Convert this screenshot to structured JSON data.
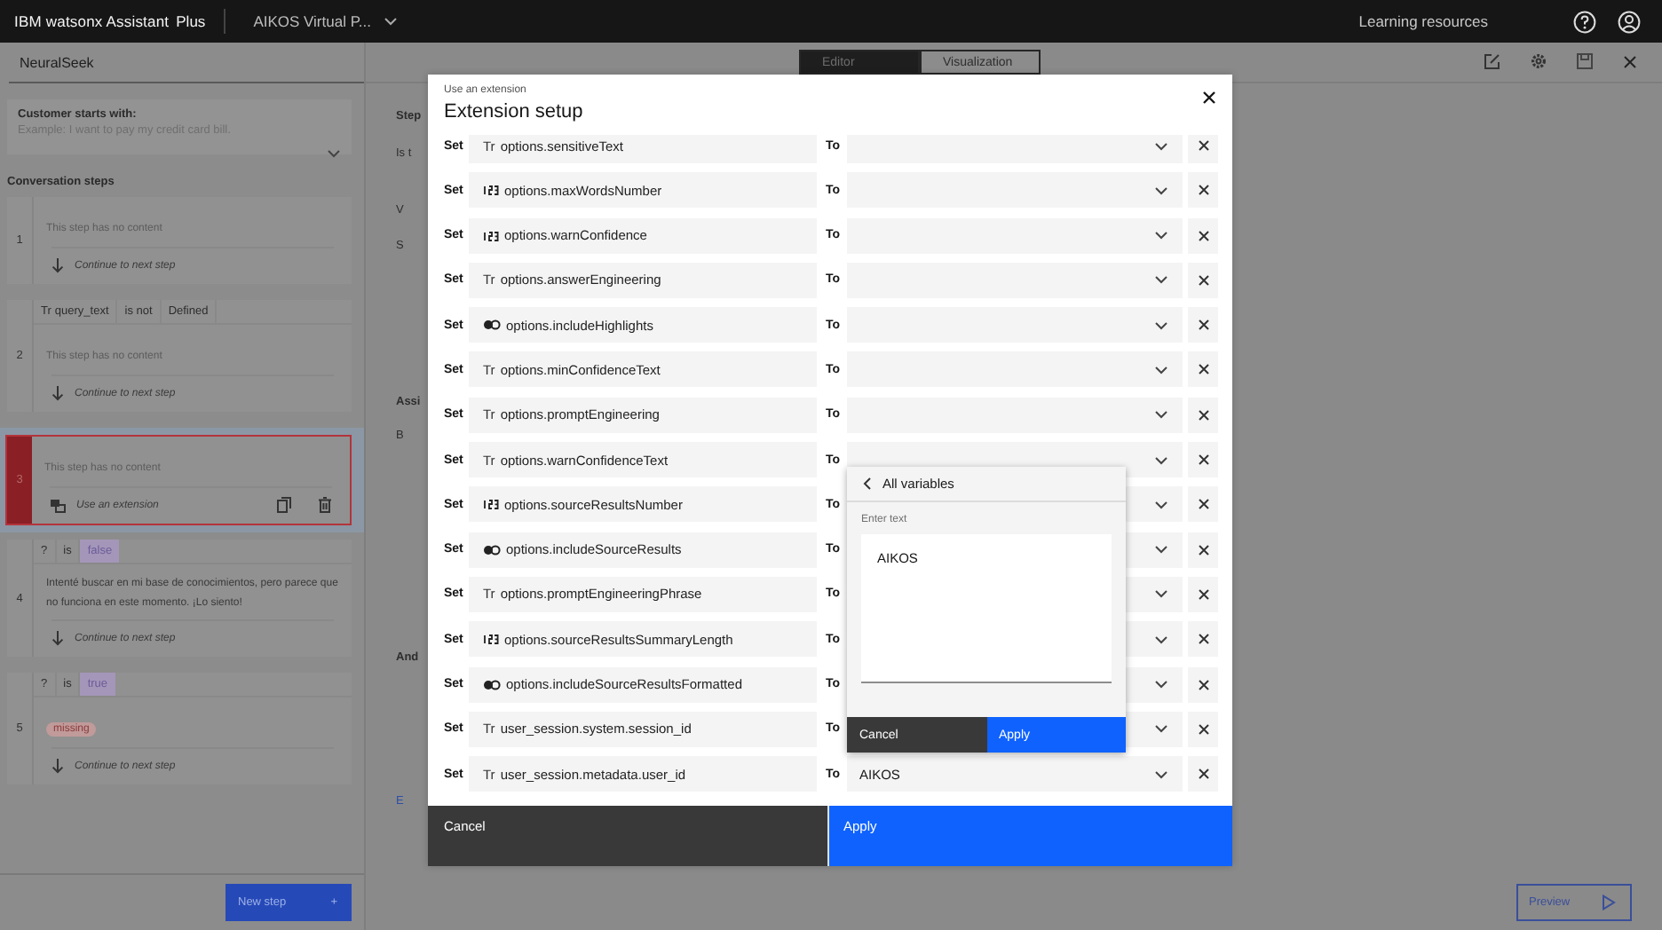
{
  "header": {
    "product": "IBM watsonx Assistant",
    "plan": "Plus",
    "assistant": "AIKOS Virtual P...",
    "link": "Learning resources"
  },
  "sidebar": {
    "action_title": "NeuralSeek",
    "starts_with": {
      "label": "Customer starts with:",
      "placeholder": "Example: I want to pay my credit card bill."
    },
    "steps_title": "Conversation steps",
    "steps": [
      {
        "number": "1",
        "selected": false,
        "content": {
          "kind": "empty",
          "text": "This step has no content"
        },
        "action": {
          "kind": "continue",
          "label": "Continue to next step"
        }
      },
      {
        "number": "2",
        "selected": false,
        "condition": [
          {
            "kind": "variable",
            "icon": "Tr",
            "text": "query_text"
          },
          {
            "kind": "operator",
            "text": "is not"
          },
          {
            "kind": "value",
            "text": "Defined"
          }
        ],
        "content": {
          "kind": "empty",
          "text": "This step has no content"
        },
        "action": {
          "kind": "continue",
          "label": "Continue to next step"
        }
      },
      {
        "number": "3",
        "selected": true,
        "content": {
          "kind": "empty",
          "text": "This step has no content"
        },
        "action": {
          "kind": "extension",
          "label": "Use an extension"
        }
      },
      {
        "number": "4",
        "selected": false,
        "condition": [
          {
            "kind": "variable",
            "text": "?"
          },
          {
            "kind": "operator",
            "text": "is"
          },
          {
            "kind": "tag",
            "text": "false"
          }
        ],
        "content": {
          "kind": "text",
          "text": "Intenté buscar en mi base de conocimientos, pero parece que no funciona en este momento. ¡Lo siento!"
        },
        "action": {
          "kind": "continue",
          "label": "Continue to next step"
        }
      },
      {
        "number": "5",
        "selected": false,
        "condition": [
          {
            "kind": "variable",
            "text": "?"
          },
          {
            "kind": "operator",
            "text": "is"
          },
          {
            "kind": "tag",
            "text": "true"
          }
        ],
        "content": {
          "kind": "tag",
          "text": "missing"
        },
        "action": {
          "kind": "continue",
          "label": "Continue to next step"
        }
      }
    ],
    "new_step": "New step",
    "new_step_icon": "+"
  },
  "editor_tabs": [
    {
      "label": "Editor",
      "selected": true
    },
    {
      "label": "Visualization",
      "selected": false
    }
  ],
  "background_fragments": [
    {
      "kind": "heading",
      "text": "Step"
    },
    {
      "kind": "text",
      "text": "Is t"
    },
    {
      "kind": "text",
      "text": "V"
    },
    {
      "kind": "text",
      "text": "S"
    },
    {
      "kind": "heading",
      "text": "Assi"
    },
    {
      "kind": "text",
      "text": "B"
    },
    {
      "kind": "heading",
      "text": "And"
    },
    {
      "kind": "link",
      "text": "E"
    }
  ],
  "preview": "Preview",
  "modal": {
    "subtitle": "Use an extension",
    "title": "Extension setup",
    "rows": [
      {
        "kind": "text",
        "type_icon": "Tr",
        "set_label": "Set",
        "name": "options.sensitiveText",
        "to_label": "To"
      },
      {
        "kind": "number",
        "set_label": "Set",
        "name": "options.maxWordsNumber",
        "to_label": "To"
      },
      {
        "kind": "number",
        "set_label": "Set",
        "name": "options.warnConfidence",
        "to_label": "To"
      },
      {
        "kind": "text",
        "type_icon": "Tr",
        "set_label": "Set",
        "name": "options.answerEngineering",
        "to_label": "To"
      },
      {
        "kind": "boolean",
        "set_label": "Set",
        "name": "options.includeHighlights",
        "to_label": "To"
      },
      {
        "kind": "text",
        "type_icon": "Tr",
        "set_label": "Set",
        "name": "options.minConfidenceText",
        "to_label": "To"
      },
      {
        "kind": "text",
        "type_icon": "Tr",
        "set_label": "Set",
        "name": "options.promptEngineering",
        "to_label": "To"
      },
      {
        "kind": "text",
        "type_icon": "Tr",
        "set_label": "Set",
        "name": "options.warnConfidenceText",
        "to_label": "To"
      },
      {
        "kind": "number",
        "set_label": "Set",
        "name": "options.sourceResultsNumber",
        "to_label": "To"
      },
      {
        "kind": "boolean",
        "set_label": "Set",
        "name": "options.includeSourceResults",
        "to_label": "To"
      },
      {
        "kind": "text",
        "type_icon": "Tr",
        "set_label": "Set",
        "name": "options.promptEngineeringPhrase",
        "to_label": "To"
      },
      {
        "kind": "number",
        "set_label": "Set",
        "name": "options.sourceResultsSummaryLength",
        "to_label": "To"
      },
      {
        "kind": "boolean",
        "set_label": "Set",
        "name": "options.includeSourceResultsFormatted",
        "to_label": "To"
      },
      {
        "kind": "text",
        "type_icon": "Tr",
        "set_label": "Set",
        "name": "user_session.system.session_id",
        "to_label": "To"
      },
      {
        "kind": "text",
        "type_icon": "Tr",
        "set_label": "Set",
        "name": "user_session.metadata.user_id",
        "to_label": "To",
        "value": "AIKOS"
      }
    ],
    "popover": {
      "back_label": "All variables",
      "field_label": "Enter text",
      "value": "AIKOS",
      "cancel": "Cancel",
      "apply": "Apply"
    },
    "cancel": "Cancel",
    "apply": "Apply"
  }
}
